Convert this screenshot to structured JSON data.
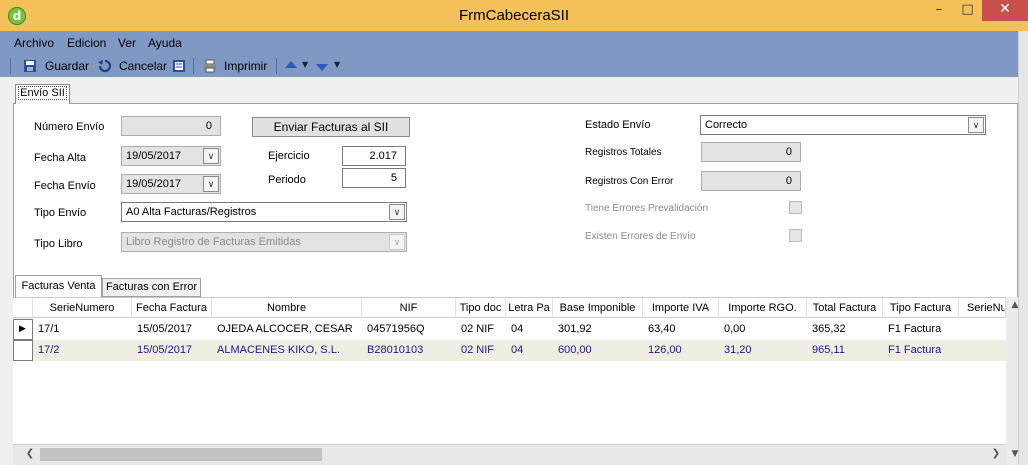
{
  "window": {
    "title": "FrmCabeceraSII",
    "app_icon_letter": "d"
  },
  "menu": [
    {
      "label": "Archivo"
    },
    {
      "label": "Edicion"
    },
    {
      "label": "Ver"
    },
    {
      "label": "Ayuda"
    }
  ],
  "toolbar": {
    "save_label": "Guardar",
    "cancel_label": "Cancelar",
    "print_label": "Imprimir"
  },
  "main_tab": {
    "label": "Envío SII"
  },
  "form": {
    "numero_envio": {
      "label": "Número Envío",
      "value": "0"
    },
    "enviar_button": "Enviar Facturas al SII",
    "fecha_alta": {
      "label": "Fecha Alta",
      "value": "19/05/2017"
    },
    "fecha_envio": {
      "label": "Fecha Envío",
      "value": "19/05/2017"
    },
    "ejercicio": {
      "label": "Ejercicio",
      "value": "2.017"
    },
    "periodo": {
      "label": "Periodo",
      "value": "5"
    },
    "tipo_envio": {
      "label": "Tipo Envío",
      "value": "A0  Alta Facturas/Registros"
    },
    "tipo_libro": {
      "label": "Tipo Libro",
      "value": "Libro Registro de Facturas Emitidas"
    },
    "estado_envio": {
      "label": "Estado Envío",
      "value": "Correcto"
    },
    "registros_totales": {
      "label": "Registros Totales",
      "value": "0"
    },
    "registros_error": {
      "label": "Registros Con Error",
      "value": "0"
    },
    "tiene_errores": {
      "label": "Tiene Errores Prevalidación"
    },
    "existen_errores": {
      "label": "Existen Errores de Envío"
    }
  },
  "sub_tabs": {
    "ventas": "Facturas Venta",
    "error": "Facturas con Error"
  },
  "grid": {
    "columns": [
      "SerieNumero",
      "Fecha Factura",
      "Nombre",
      "NIF",
      "Tipo doc",
      "Letra Pa",
      "Base Imponible",
      "Importe IVA",
      "Importe RGO.",
      "Total Factura",
      "Tipo Factura",
      "SerieNu"
    ],
    "rows": [
      {
        "serie": "17/1",
        "fecha": "15/05/2017",
        "nombre": "OJEDA ALCOCER, CESAR",
        "nif": "04571956Q",
        "tipo_doc": "02 NIF",
        "letra": "04",
        "base": "301,92",
        "iva": "63,40",
        "rgo": "0,00",
        "total": "365,32",
        "tipo_factura": "F1 Factura"
      },
      {
        "serie": "17/2",
        "fecha": "15/05/2017",
        "nombre": "ALMACENES KIKO, S.L.",
        "nif": "B28010103",
        "tipo_doc": "02 NIF",
        "letra": "04",
        "base": "600,00",
        "iva": "126,00",
        "rgo": "31,20",
        "total": "965,11",
        "tipo_factura": "F1 Factura"
      }
    ]
  },
  "colors": {
    "title_bar": "#f3c05a",
    "menu_bar": "#7f99c4",
    "alt_row": "#f0ede3"
  }
}
